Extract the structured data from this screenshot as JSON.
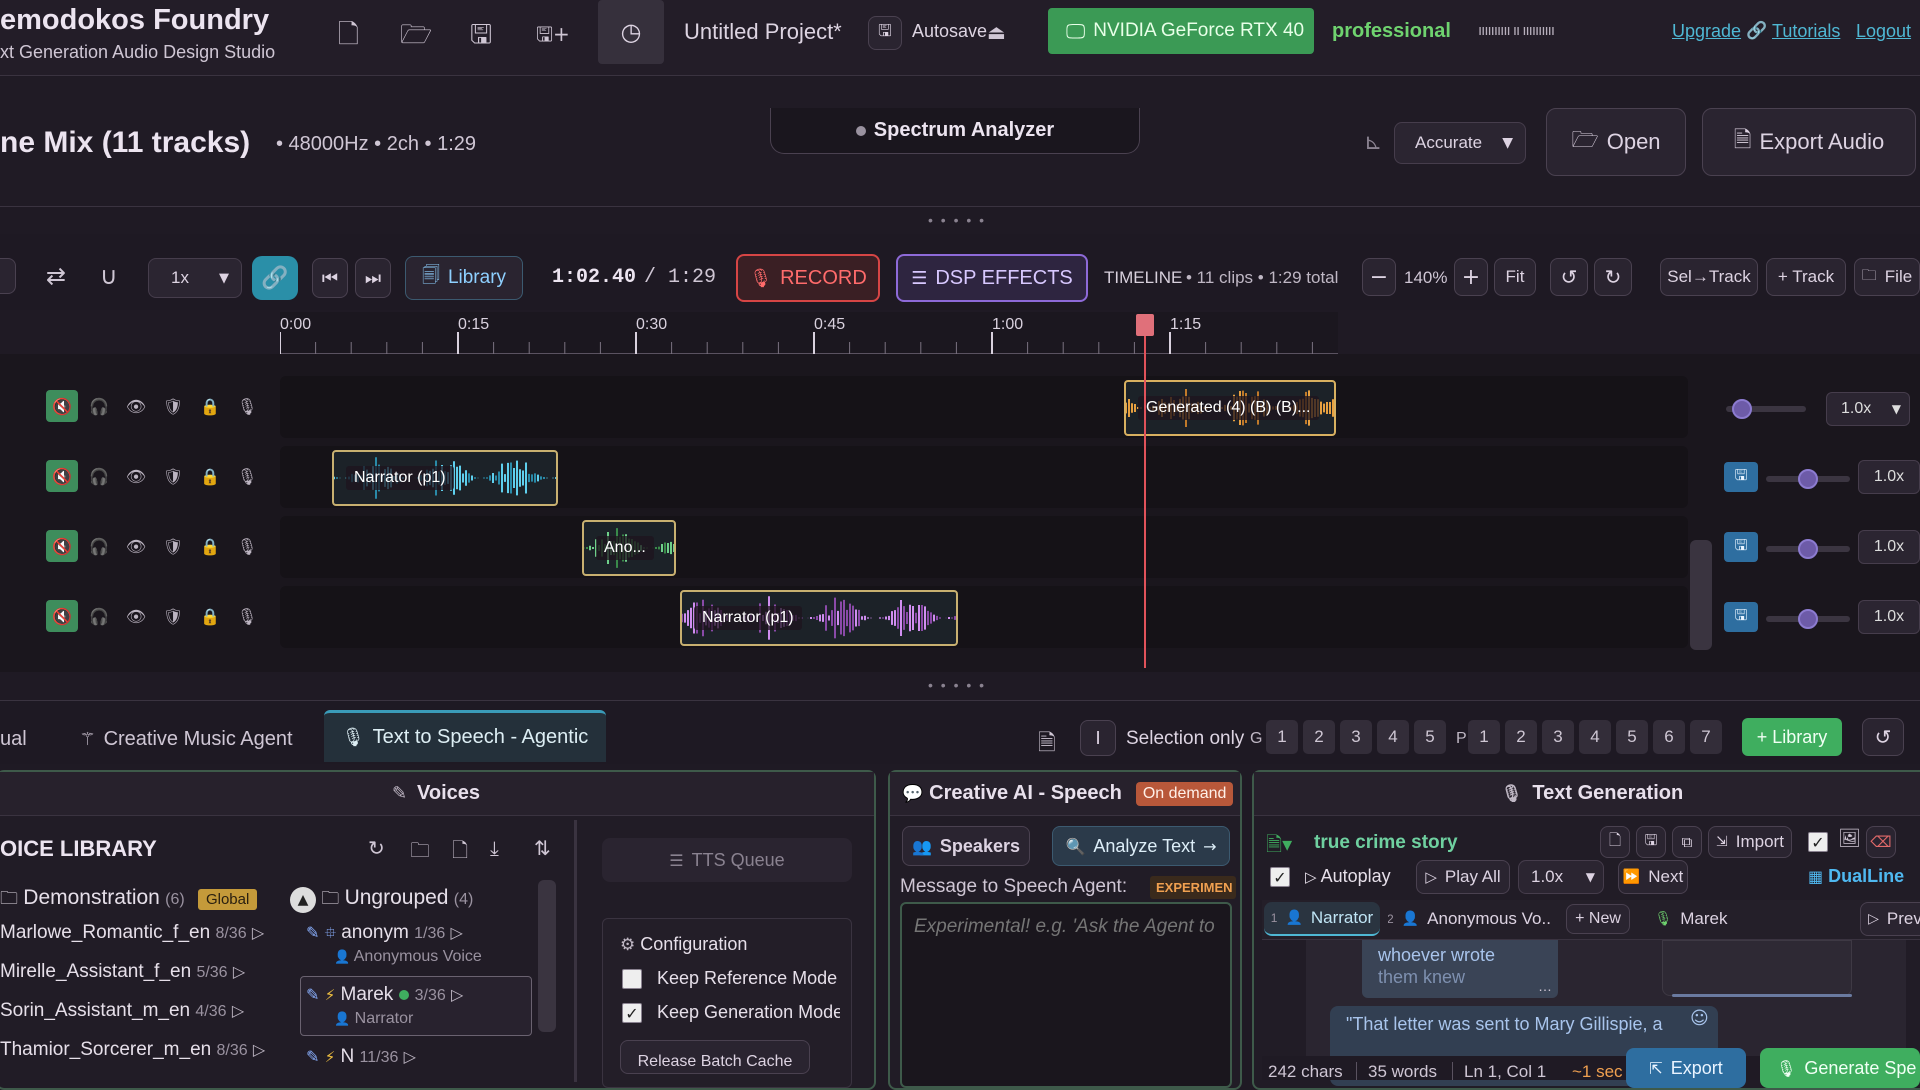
{
  "app": {
    "title": "emodokos Foundry",
    "subtitle": "xt Generation Audio Design Studio",
    "project_name": "Untitled Project*",
    "autosave_label": "Autosave",
    "gpu_label": "NVIDIA GeForce RTX 40",
    "tier_label": "professional",
    "scribble": "ıııııııııı ıı ıııııııııı",
    "upgrade_label": "Upgrade",
    "tutorials_label": "Tutorials",
    "logout_label": "Logout"
  },
  "mix": {
    "title": "ne Mix (11 tracks)",
    "meta": "• 48000Hz • 2ch • 1:29",
    "spectrum_label": "Spectrum Analyzer",
    "mode_select": "Accurate",
    "open_label": "Open",
    "export_label": "Export Audio"
  },
  "transport": {
    "speed": "1x",
    "library_label": "Library",
    "current_time": "1:02.40",
    "total_time": "/ 1:29",
    "record_label": "RECORD",
    "dsp_label": "DSP EFFECTS",
    "timeline_label": "TIMELINE",
    "timeline_meta": "• 11 clips • 1:29 total",
    "zoom": "140%",
    "fit_label": "Fit",
    "sel_track_label": "Sel→Track",
    "add_track_label": "+ Track",
    "file_label": "File"
  },
  "ruler": {
    "ticks": [
      "0:00",
      "0:15",
      "0:30",
      "0:45",
      "1:00",
      "1:15"
    ],
    "playhead_fraction": 0.6135
  },
  "tracks": [
    {
      "clip_label": "Generated (4) (B) (B)...",
      "speed": "1.0x"
    },
    {
      "clip_label": "Narrator (p1)",
      "speed": "1.0x"
    },
    {
      "clip_label": "Ano...",
      "speed": "1.0x"
    },
    {
      "clip_label": "Narrator (p1)",
      "speed": "1.0x"
    }
  ],
  "tabs": {
    "manual_label": "ual",
    "creative_music_label": "Creative Music Agent",
    "tts_label": "Text to Speech - Agentic",
    "selection_only": "Selection only",
    "g_label": "G",
    "g_numbers": [
      "1",
      "2",
      "3",
      "4",
      "5"
    ],
    "p_label": "P",
    "p_numbers": [
      "1",
      "2",
      "3",
      "4",
      "5",
      "6",
      "7"
    ],
    "library_button": "+ Library"
  },
  "voices": {
    "header": "Voices",
    "library_title": "OICE LIBRARY",
    "demo_group": "Demonstration",
    "demo_count": "(6)",
    "demo_badge": "Global",
    "left_voices": [
      {
        "name": "Marlowe_Romantic_f_en",
        "count": "8/36"
      },
      {
        "name": "Mirelle_Assistant_f_en",
        "count": "5/36"
      },
      {
        "name": "Sorin_Assistant_m_en",
        "count": "4/36"
      },
      {
        "name": "Thamior_Sorcerer_m_en",
        "count": "8/36"
      }
    ],
    "ungrouped_label": "Ungrouped",
    "ungrouped_count": "(4)",
    "right_voices": [
      {
        "name": "anonym",
        "count": "1/36",
        "role": "Anonymous Voice"
      },
      {
        "name": "Marek",
        "count": "3/36",
        "role": "Narrator"
      },
      {
        "name": "N",
        "count": "11/36",
        "role": ""
      }
    ],
    "tts_queue_label": "TTS Queue",
    "config_label": "Configuration",
    "keep_reference": "Keep Reference Mode",
    "keep_generation": "Keep Generation Mode",
    "release_cache": "Release Batch Cache"
  },
  "creative_ai": {
    "header": "Creative AI - Speech",
    "badge": "On demand",
    "speakers_label": "Speakers",
    "analyze_label": "Analyze Text",
    "message_label": "Message to Speech Agent:",
    "experimental_badge": "EXPERIMEN",
    "placeholder": "Experimental! e.g. 'Ask the Agent to"
  },
  "text_gen": {
    "header": "Text Generation",
    "doc_title": "true crime story",
    "import_label": "Import",
    "autoplay_label": "Autoplay",
    "play_all_label": "Play All",
    "speed": "1.0x",
    "next_label": "Next",
    "dualline_label": "DualLine",
    "speaker_tabs": [
      "Narrator",
      "Anonymous Vo..",
      "+ New",
      "Marek"
    ],
    "speaker_nums": [
      "1",
      "2"
    ],
    "prev_label": "Prev",
    "line1": "whoever wrote",
    "line2": "them knew",
    "quote": "\"That letter was sent to Mary Gillispie, a",
    "chars": "242 chars",
    "words": "35 words",
    "cursor": "Ln 1, Col 1",
    "seconds": "~1 sec",
    "export_label": "Export",
    "generate_label": "Generate Spe"
  },
  "colors": {
    "accent_green": "#3fae5f",
    "record_red": "#e24a4a",
    "dsp_purple": "#8e6ad8",
    "link_teal": "#2a8fa8",
    "tier_green": "#6fd36f",
    "playhead": "#e0525a"
  }
}
